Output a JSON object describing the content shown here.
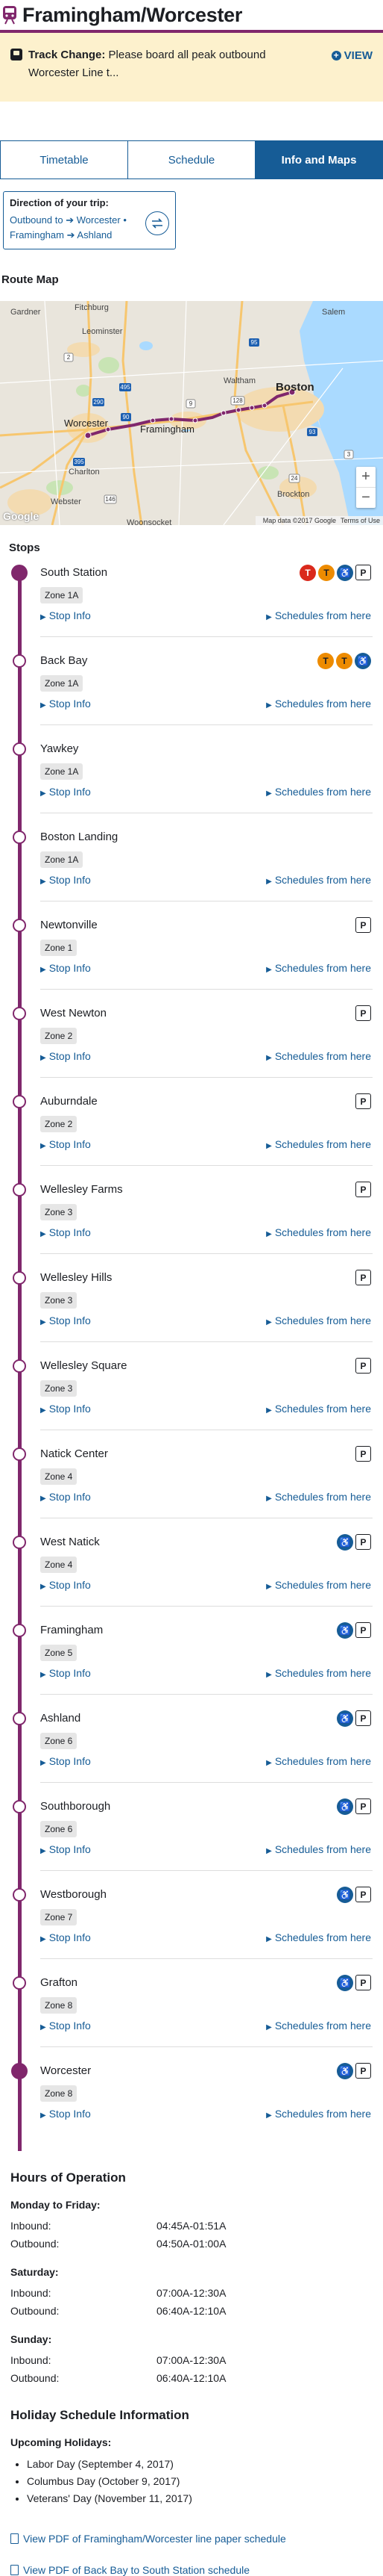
{
  "header": {
    "title": "Framingham/Worcester"
  },
  "alert": {
    "title": "Track Change:",
    "text": "Please board all peak outbound Worcester Line t...",
    "view": "VIEW"
  },
  "tabs": [
    "Timetable",
    "Schedule",
    "Info and Maps"
  ],
  "direction": {
    "label": "Direction of your trip:",
    "direction": "Outbound",
    "to_word": "to",
    "to": "Worcester",
    "via1": "Framingham",
    "via2": "Ashland"
  },
  "route_map": {
    "title": "Route Map",
    "attribution": "Map data ©2017 Google",
    "terms": "Terms of Use",
    "google": "Google",
    "towns": [
      "Gardner",
      "Fitchburg",
      "Leominster",
      "Salem",
      "Waltham",
      "Boston",
      "Worcester",
      "Framingham",
      "Charlton",
      "Brockton",
      "Webster",
      "Woonsocket"
    ],
    "road_labels": [
      "2",
      "95",
      "128",
      "90",
      "290",
      "395",
      "495",
      "93",
      "24",
      "146",
      "3",
      "9"
    ]
  },
  "stops_title": "Stops",
  "stop_info_label": "Stop Info",
  "schedules_label": "Schedules from here",
  "stops": [
    {
      "name": "South Station",
      "zone": "Zone 1A",
      "icons": [
        "T",
        "SL",
        "♿",
        "P"
      ]
    },
    {
      "name": "Back Bay",
      "zone": "Zone 1A",
      "icons": [
        "T",
        "OL",
        "♿"
      ]
    },
    {
      "name": "Yawkey",
      "zone": "Zone 1A",
      "icons": []
    },
    {
      "name": "Boston Landing",
      "zone": "Zone 1A",
      "icons": []
    },
    {
      "name": "Newtonville",
      "zone": "Zone 1",
      "icons": [
        "P"
      ]
    },
    {
      "name": "West Newton",
      "zone": "Zone 2",
      "icons": [
        "P"
      ]
    },
    {
      "name": "Auburndale",
      "zone": "Zone 2",
      "icons": [
        "P"
      ]
    },
    {
      "name": "Wellesley Farms",
      "zone": "Zone 3",
      "icons": [
        "P"
      ]
    },
    {
      "name": "Wellesley Hills",
      "zone": "Zone 3",
      "icons": [
        "P"
      ]
    },
    {
      "name": "Wellesley Square",
      "zone": "Zone 3",
      "icons": [
        "P"
      ]
    },
    {
      "name": "Natick Center",
      "zone": "Zone 4",
      "icons": [
        "P"
      ]
    },
    {
      "name": "West Natick",
      "zone": "Zone 4",
      "icons": [
        "♿",
        "P"
      ]
    },
    {
      "name": "Framingham",
      "zone": "Zone 5",
      "icons": [
        "♿",
        "P"
      ]
    },
    {
      "name": "Ashland",
      "zone": "Zone 6",
      "icons": [
        "♿",
        "P"
      ]
    },
    {
      "name": "Southborough",
      "zone": "Zone 6",
      "icons": [
        "♿",
        "P"
      ]
    },
    {
      "name": "Westborough",
      "zone": "Zone 7",
      "icons": [
        "♿",
        "P"
      ]
    },
    {
      "name": "Grafton",
      "zone": "Zone 8",
      "icons": [
        "♿",
        "P"
      ]
    },
    {
      "name": "Worcester",
      "zone": "Zone 8",
      "icons": [
        "♿",
        "P"
      ]
    }
  ],
  "hours": {
    "title": "Hours of Operation",
    "groups": [
      {
        "label": "Monday to Friday:",
        "rows": [
          {
            "dir": "Inbound:",
            "time": "04:45A-01:51A"
          },
          {
            "dir": "Outbound:",
            "time": "04:50A-01:00A"
          }
        ]
      },
      {
        "label": "Saturday:",
        "rows": [
          {
            "dir": "Inbound:",
            "time": "07:00A-12:30A"
          },
          {
            "dir": "Outbound:",
            "time": "06:40A-12:10A"
          }
        ]
      },
      {
        "label": "Sunday:",
        "rows": [
          {
            "dir": "Inbound:",
            "time": "07:00A-12:30A"
          },
          {
            "dir": "Outbound:",
            "time": "06:40A-12:10A"
          }
        ]
      }
    ]
  },
  "holiday": {
    "title": "Holiday Schedule Information",
    "subtitle": "Upcoming Holidays:",
    "items": [
      "Labor Day (September 4, 2017)",
      "Columbus Day (October 9, 2017)",
      "Veterans' Day (November 11, 2017)"
    ]
  },
  "pdfs": [
    "View PDF of Framingham/Worcester line paper schedule",
    "View PDF of Back Bay to South Station schedule"
  ],
  "colors": {
    "line": "#80276c",
    "link": "#165c96",
    "alert_bg": "#fdf1cd"
  }
}
